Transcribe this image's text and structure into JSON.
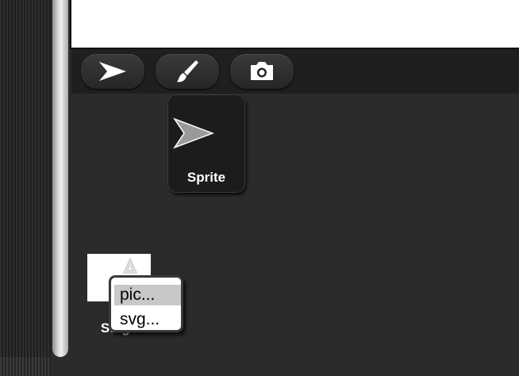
{
  "corral": {
    "tool_buttons": [
      {
        "name": "turtle",
        "icon": "turtle-arrow-icon"
      },
      {
        "name": "paint",
        "icon": "paintbrush-icon"
      },
      {
        "name": "camera",
        "icon": "camera-icon"
      }
    ],
    "sprite": {
      "label": "Sprite",
      "icon": "turtle-arrow-icon"
    },
    "stage": {
      "label": "Stage",
      "icon": "stage-thumbnail"
    }
  },
  "context_menu": {
    "items": [
      {
        "label": "pic...",
        "highlighted": true
      },
      {
        "label": "svg...",
        "highlighted": false
      }
    ]
  },
  "colors": {
    "background": "#2a2a2a",
    "menu_highlight": "#c8c8c8",
    "editor": "#ffffff"
  }
}
